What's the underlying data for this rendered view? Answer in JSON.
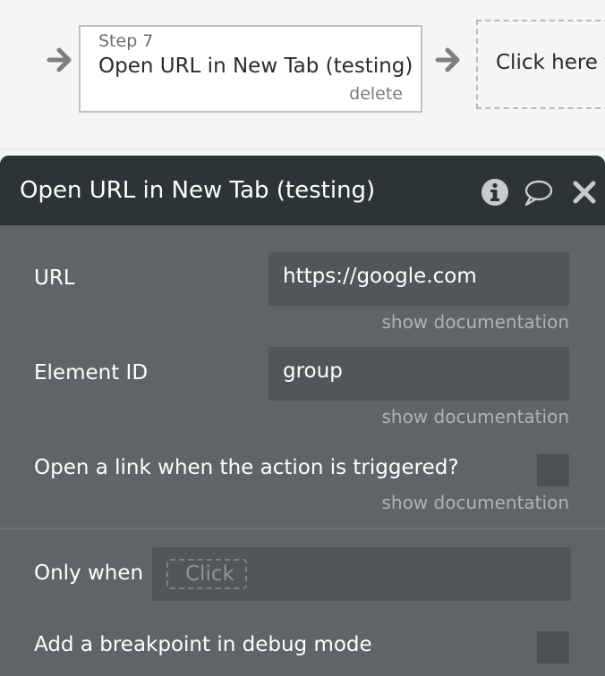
{
  "workflow": {
    "step": {
      "number_label": "Step 7",
      "title": "Open URL in New Tab (testing)",
      "delete_label": "delete"
    },
    "new_step_label": "Click here t"
  },
  "panel": {
    "title": "Open URL in New Tab (testing)",
    "fields": [
      {
        "label": "URL",
        "value": "https://google.com",
        "doc_link": "show documentation"
      },
      {
        "label": "Element ID",
        "value": "group",
        "doc_link": "show documentation"
      }
    ],
    "checkbox_field": {
      "label": "Open a link when the action is triggered?",
      "checked": false,
      "doc_link": "show documentation"
    },
    "only_when": {
      "label": "Only when",
      "placeholder": "Click"
    },
    "breakpoint": {
      "label": "Add a breakpoint in debug mode",
      "checked": false
    }
  },
  "colors": {
    "canvas_bg": "#f5f5f5",
    "panel_bg": "#5f6466",
    "panel_header_bg": "#2c3436",
    "field_bg": "#525658",
    "doc_link": "#aeb3b4"
  },
  "icons": [
    "arrow-right-icon",
    "info-icon",
    "comment-icon",
    "close-icon"
  ]
}
